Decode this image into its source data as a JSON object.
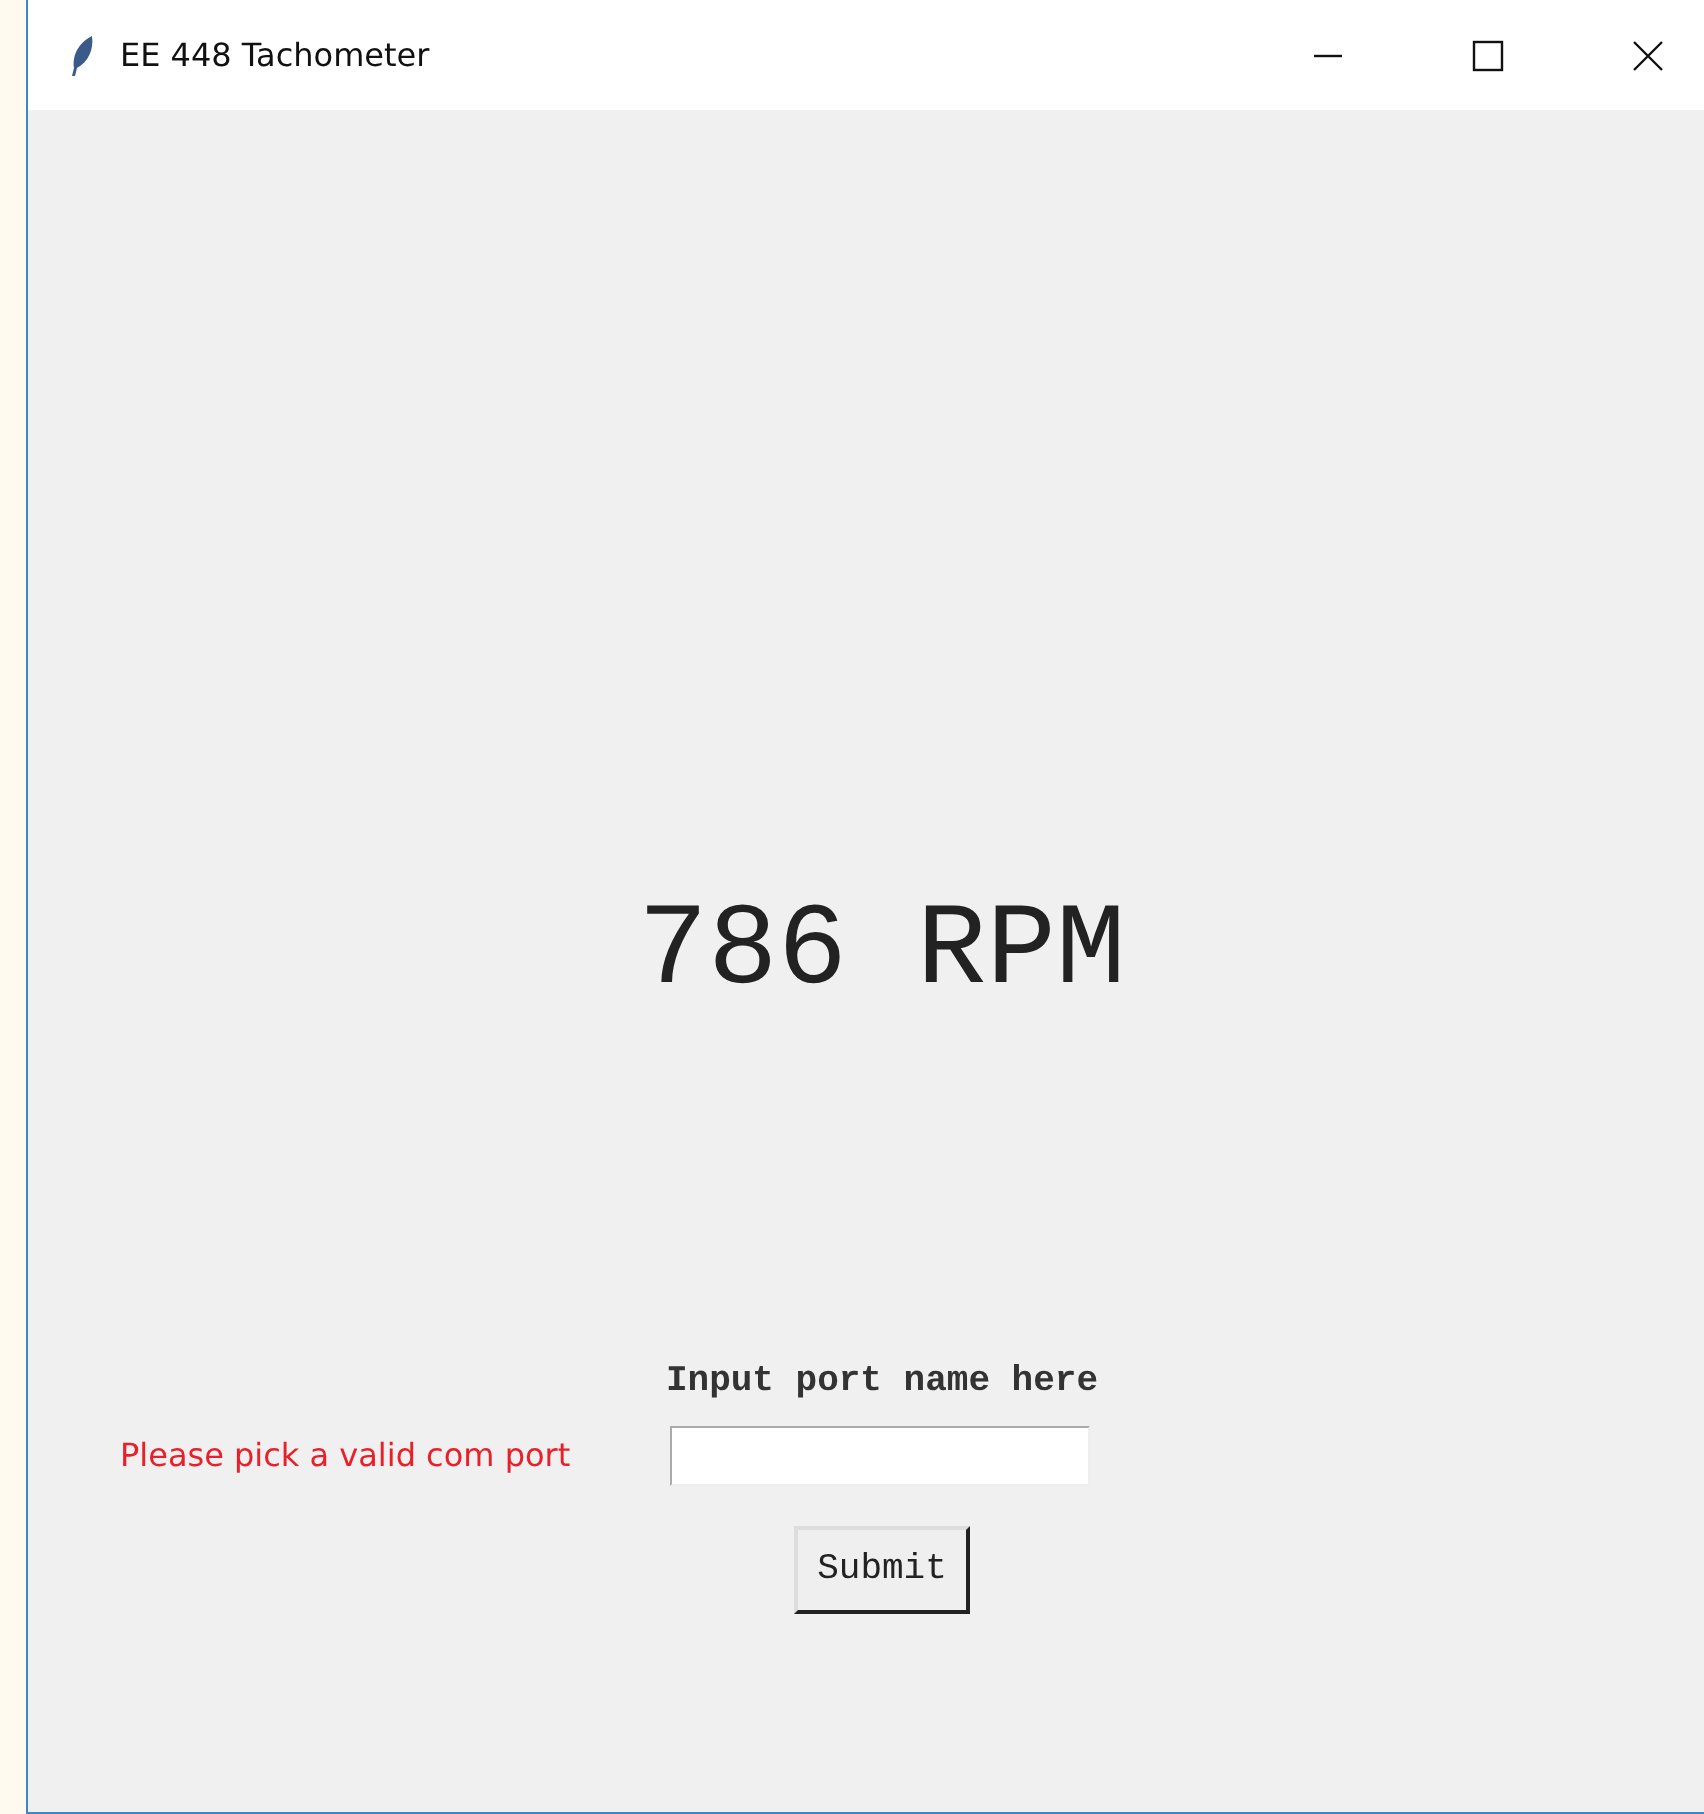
{
  "window": {
    "title": "EE 448 Tachometer"
  },
  "reading": "786 RPM",
  "prompt": "Input port name here",
  "error": "Please pick a valid com port",
  "button": "Submit"
}
